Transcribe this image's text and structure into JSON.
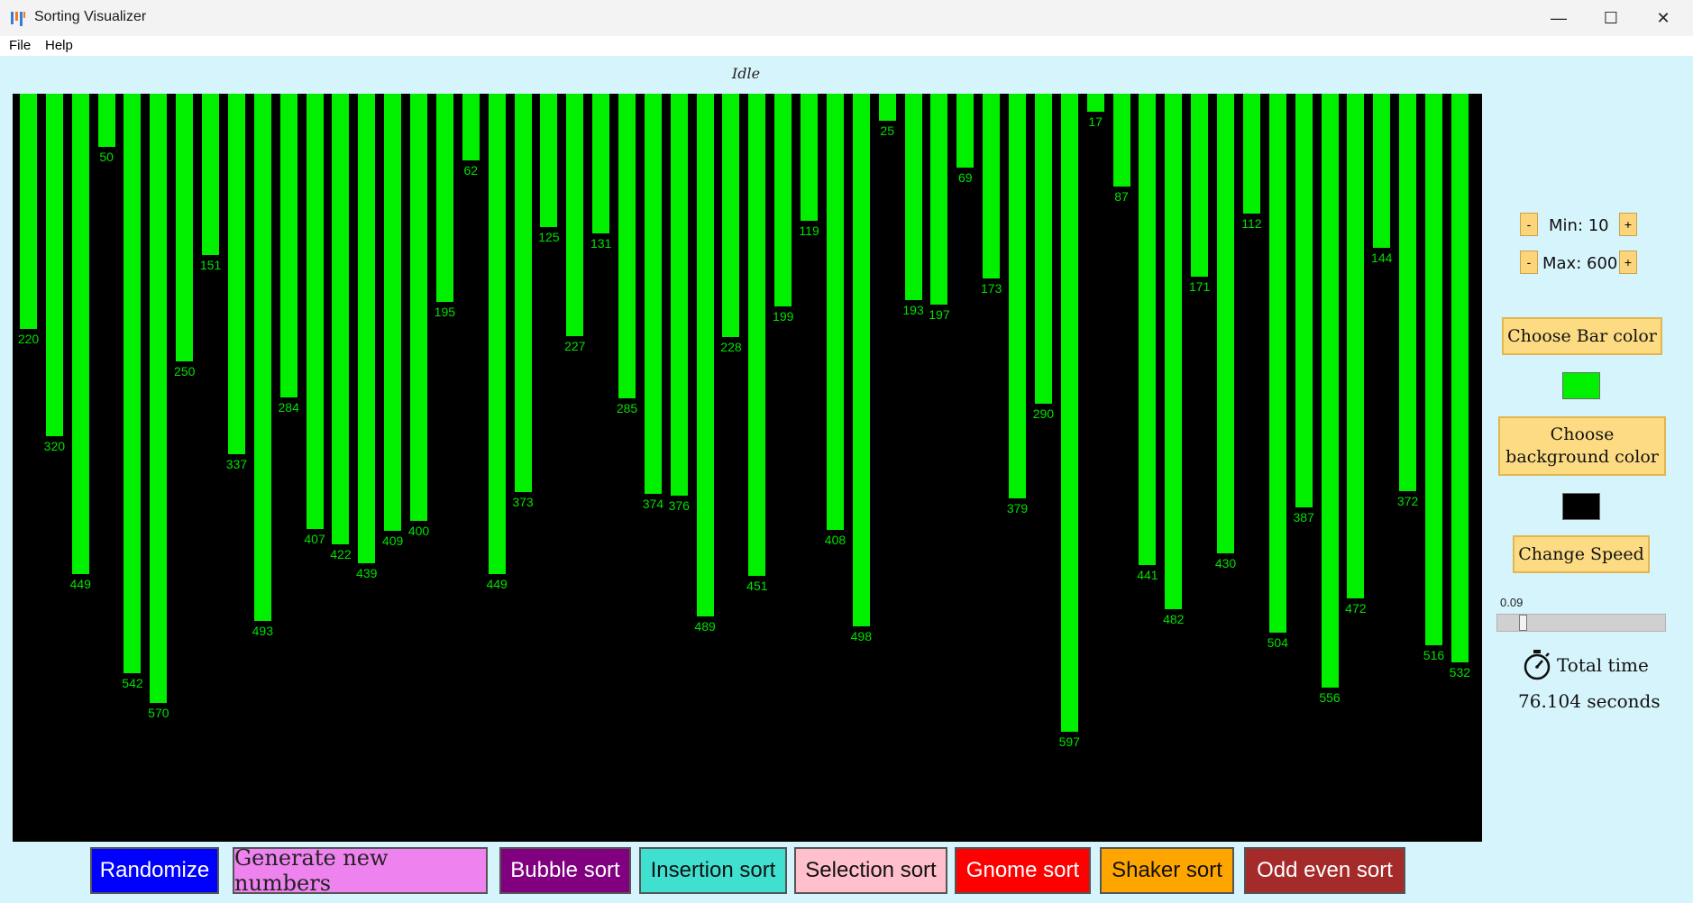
{
  "window": {
    "title": "Sorting Visualizer",
    "minimize_icon": "—",
    "maximize_icon": "☐",
    "close_icon": "✕"
  },
  "menu": {
    "items": [
      "File",
      "Help"
    ]
  },
  "status": "Idle",
  "visualizer": {
    "bar_color": "#00f000",
    "background_color": "#000000",
    "values": [
      220,
      320,
      449,
      50,
      542,
      570,
      250,
      151,
      337,
      493,
      284,
      407,
      422,
      439,
      409,
      400,
      195,
      62,
      449,
      373,
      125,
      227,
      131,
      285,
      374,
      376,
      489,
      228,
      451,
      199,
      119,
      408,
      498,
      25,
      193,
      197,
      69,
      173,
      379,
      290,
      597,
      17,
      87,
      441,
      482,
      171,
      430,
      112,
      504,
      387,
      556,
      472,
      144,
      372,
      516,
      532
    ]
  },
  "controls": {
    "min_label": "Min: 10",
    "max_label": "Max: 600",
    "minus": "-",
    "plus": "+",
    "choose_bar_color": "Choose Bar color",
    "choose_background_color": "Choose background color",
    "change_speed": "Change Speed",
    "speed_value": "0.09",
    "speed_fraction": 0.09,
    "total_time_label": "Total time",
    "total_time_value": "76.104 seconds",
    "timer_icon": "stopwatch-icon"
  },
  "buttons": [
    {
      "label": "Randomize",
      "bg": "#0000ff",
      "fg": "#ffffff"
    },
    {
      "label": "Generate new numbers",
      "bg": "#ee82ee",
      "fg": "#222222"
    },
    {
      "label": "Bubble sort",
      "bg": "#800080",
      "fg": "#ffffff"
    },
    {
      "label": "Insertion sort",
      "bg": "#40e0d0",
      "fg": "#111111"
    },
    {
      "label": "Selection sort",
      "bg": "#ffc0cb",
      "fg": "#111111"
    },
    {
      "label": "Gnome sort",
      "bg": "#ff0000",
      "fg": "#ffffff"
    },
    {
      "label": "Shaker sort",
      "bg": "#ffa500",
      "fg": "#111111"
    },
    {
      "label": "Odd even sort",
      "bg": "#a52a2a",
      "fg": "#ffffff"
    }
  ]
}
